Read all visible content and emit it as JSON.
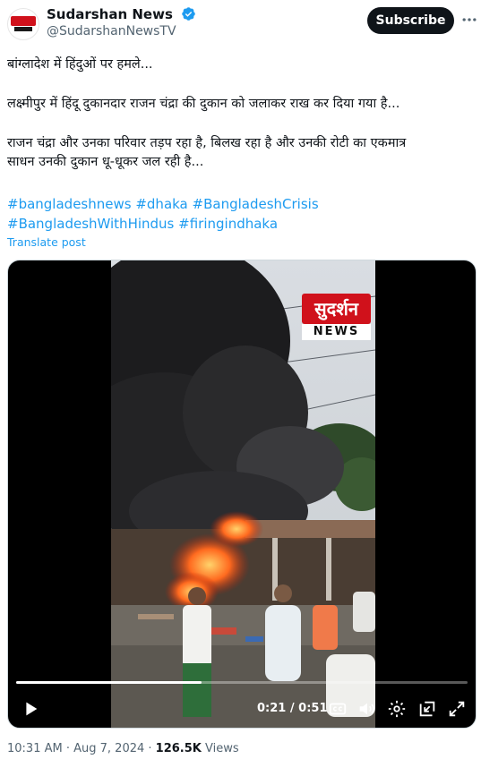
{
  "header": {
    "display_name": "Sudarshan News",
    "handle": "@SudarshanNewsTV",
    "subscribe_label": "Subscribe"
  },
  "post": {
    "line1": "बांग्लादेश में हिंदुओं पर हमले...",
    "line2": "लक्ष्मीपुर में हिंदू दुकानदार राजन चंद्रा की दुकान को जलाकर राख कर दिया गया है...",
    "line3a": "राजन चंद्रा और उनका परिवार तड़प रहा है, बिलख रहा है और उनकी रोटी का एकमात्र",
    "line3b": "साधन उनकी दुकान धू-धूकर जल रही है...",
    "hashtags": [
      "#bangladeshnews",
      "#dhaka",
      "#BangladeshCrisis",
      "#BangladeshWithHindus",
      "#firingindhaka"
    ],
    "translate_label": "Translate post"
  },
  "video": {
    "logo_top": "सुदर्शन",
    "logo_bottom": "NEWS",
    "time_current": "0:21",
    "time_total": "0:51",
    "progress_fraction": 0.41
  },
  "meta": {
    "time": "10:31 AM",
    "date": "Aug 7, 2024",
    "views_count": "126.5K",
    "views_label": "Views"
  },
  "colors": {
    "link": "#1d9bf0",
    "text": "#0f1419",
    "secondary": "#536471",
    "brand_red": "#d0111b",
    "verified": "#1d9bf0"
  }
}
